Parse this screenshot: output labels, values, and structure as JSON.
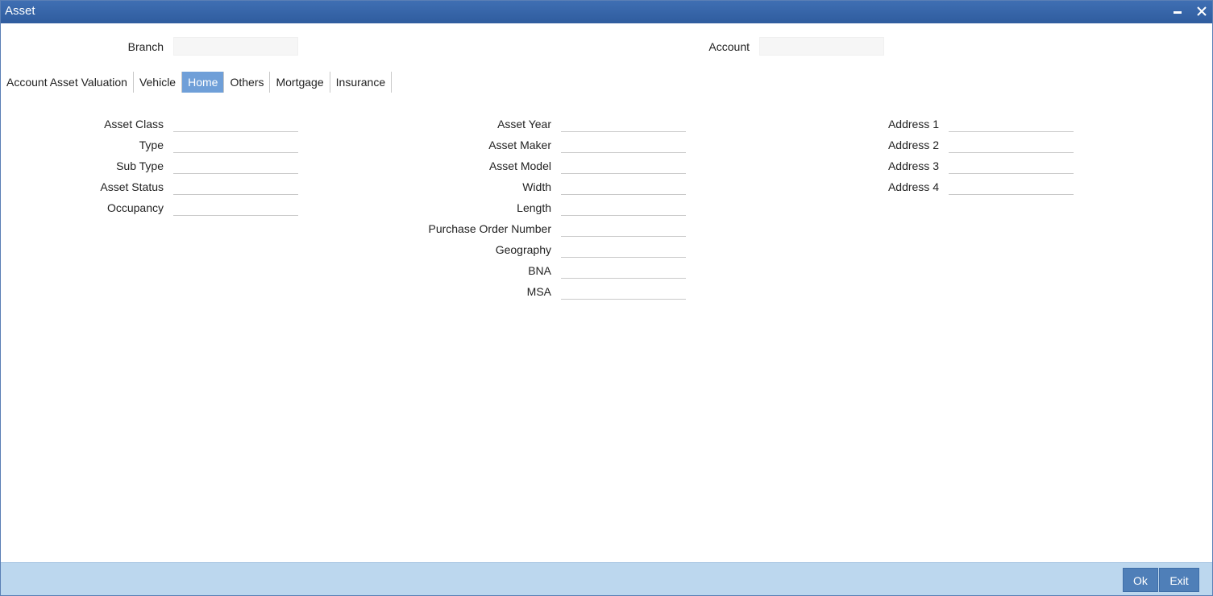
{
  "window": {
    "title": "Asset"
  },
  "header": {
    "branch_label": "Branch",
    "branch_value": "",
    "account_label": "Account",
    "account_value": ""
  },
  "tabs": [
    {
      "label": "Account Asset Valuation",
      "active": false
    },
    {
      "label": "Vehicle",
      "active": false
    },
    {
      "label": "Home",
      "active": true
    },
    {
      "label": "Others",
      "active": false
    },
    {
      "label": "Mortgage",
      "active": false
    },
    {
      "label": "Insurance",
      "active": false
    }
  ],
  "col1": [
    {
      "label": "Asset Class",
      "value": ""
    },
    {
      "label": "Type",
      "value": ""
    },
    {
      "label": "Sub Type",
      "value": ""
    },
    {
      "label": "Asset Status",
      "value": ""
    },
    {
      "label": "Occupancy",
      "value": ""
    }
  ],
  "col2": [
    {
      "label": "Asset Year",
      "value": ""
    },
    {
      "label": "Asset Maker",
      "value": ""
    },
    {
      "label": "Asset Model",
      "value": ""
    },
    {
      "label": "Width",
      "value": ""
    },
    {
      "label": "Length",
      "value": ""
    },
    {
      "label": "Purchase Order Number",
      "value": ""
    },
    {
      "label": "Geography",
      "value": ""
    },
    {
      "label": "BNA",
      "value": ""
    },
    {
      "label": "MSA",
      "value": ""
    }
  ],
  "col3": [
    {
      "label": "Address 1",
      "value": ""
    },
    {
      "label": "Address 2",
      "value": ""
    },
    {
      "label": "Address 3",
      "value": ""
    },
    {
      "label": "Address 4",
      "value": ""
    }
  ],
  "footer": {
    "ok_label": "Ok",
    "exit_label": "Exit"
  },
  "colors": {
    "titlebar": "#2f5c9e",
    "active_tab": "#6f9fd8",
    "footer": "#bcd7ee",
    "button": "#4f7fb8"
  }
}
